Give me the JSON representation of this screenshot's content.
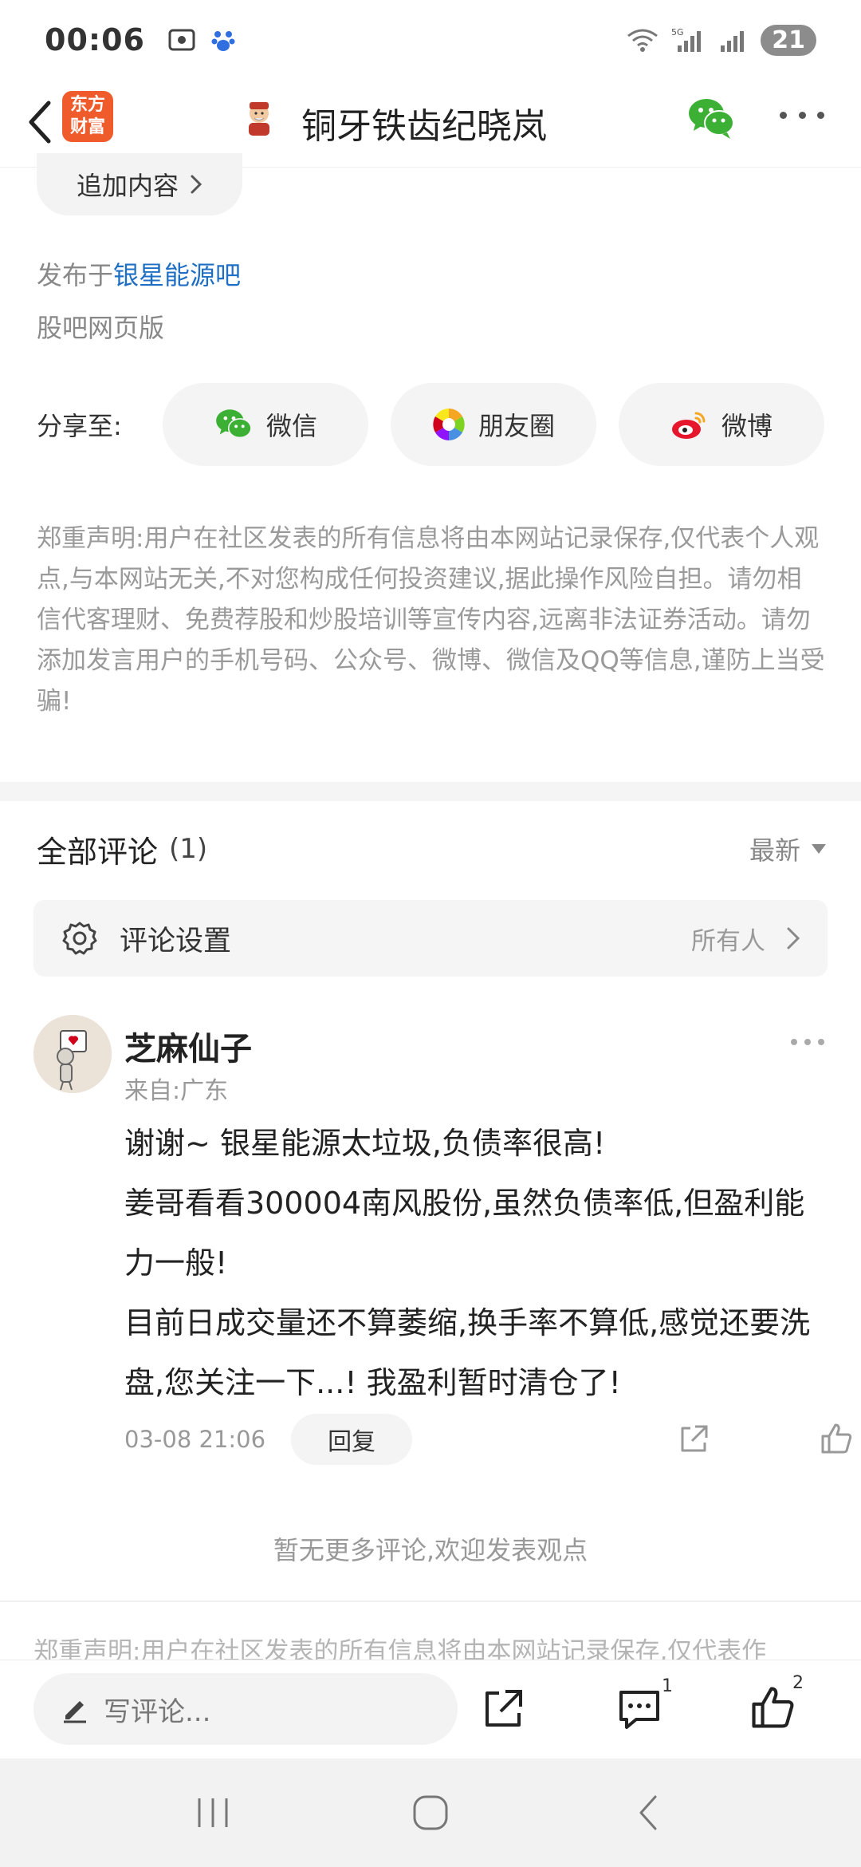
{
  "status_bar": {
    "time": "00:06",
    "battery": "21"
  },
  "nav": {
    "logo_line1": "东方",
    "logo_line2": "财富",
    "title": "铜牙铁齿纪晓岚"
  },
  "post": {
    "append_label": "追加内容",
    "published_prefix": "发布于",
    "published_bar": "银星能源吧",
    "source": "股吧网页版",
    "share_label": "分享至:",
    "share_options": [
      "微信",
      "朋友圈",
      "微博"
    ],
    "disclaimer": "郑重声明:用户在社区发表的所有信息将由本网站记录保存,仅代表个人观点,与本网站无关,不对您构成任何投资建议,据此操作风险自担。请勿相信代客理财、免费荐股和炒股培训等宣传内容,远离非法证券活动。请勿添加发言用户的手机号码、公众号、微博、微信及QQ等信息,谨防上当受骗!"
  },
  "comments": {
    "title": "全部评论",
    "count": "(1)",
    "sort": "最新",
    "settings_label": "评论设置",
    "settings_value": "所有人",
    "items": [
      {
        "name": "芝麻仙子",
        "location": "来自:广东",
        "line1": "谢谢~ 银星能源太垃圾,负债率很高!",
        "line2": "姜哥看看300004南风股份,虽然负债率低,但盈利能力一般!",
        "line3": "目前日成交量还不算萎缩,换手率不算低,感觉还要洗盘,您关注一下...! 我盈利暂时清仓了!",
        "time": "03-08 21:06",
        "reply": "回复"
      }
    ],
    "no_more": "暂无更多评论,欢迎发表观点",
    "disclaimer_repeat": "郑重声明:用户在社区发表的所有信息将由本网站记录保存,仅代表作"
  },
  "action_bar": {
    "write_placeholder": "写评论...",
    "comment_count": "1",
    "like_count": "2"
  },
  "icons": {
    "wechat_color": "#3cb034",
    "accent_link": "#1f6fc4",
    "logo_color": "#ef5b2b"
  }
}
